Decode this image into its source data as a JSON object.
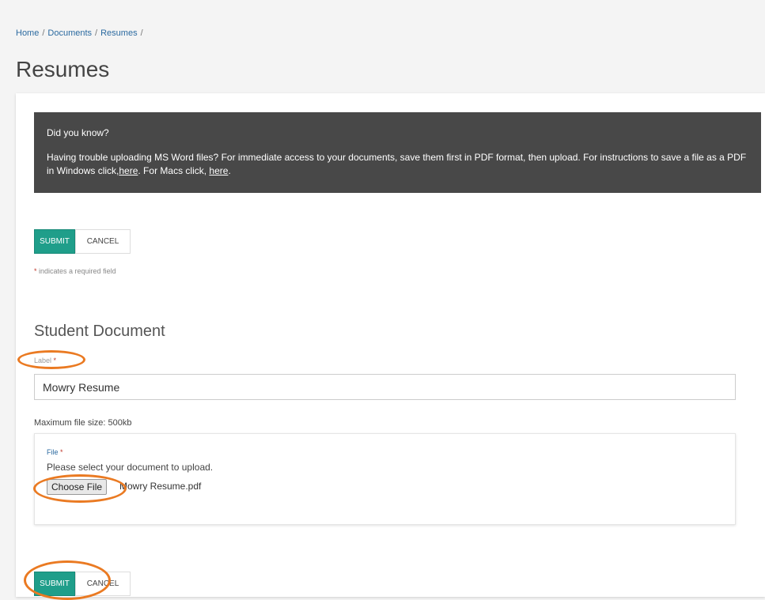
{
  "breadcrumb": {
    "items": [
      "Home",
      "Documents",
      "Resumes"
    ],
    "separator": "/"
  },
  "page_title": "Resumes",
  "tip": {
    "title": "Did you know?",
    "body_part1": "Having trouble uploading MS Word files? For immediate access to your documents, save them first in PDF format, then upload. For instructions to save a file as a PDF in Windows click,",
    "windows_link": "here",
    "body_part2": ". For Macs click, ",
    "mac_link": "here",
    "body_part3": "."
  },
  "buttons": {
    "submit": "SUBMIT",
    "cancel": "CANCEL"
  },
  "required_note": {
    "star": "*",
    "text": " indicates a required field"
  },
  "section_title": "Student Document",
  "label_field": {
    "label": "Label",
    "star": " *",
    "value": "Mowry Resume"
  },
  "max_file_size": "Maximum file size: 500kb",
  "file_field": {
    "label": "File",
    "star": " *",
    "help": "Please select your document to upload.",
    "choose_button": "Choose File",
    "file_name": "Mowry Resume.pdf"
  },
  "annotation_color": "#ea7a22",
  "accent_color": "#1f9e8a"
}
